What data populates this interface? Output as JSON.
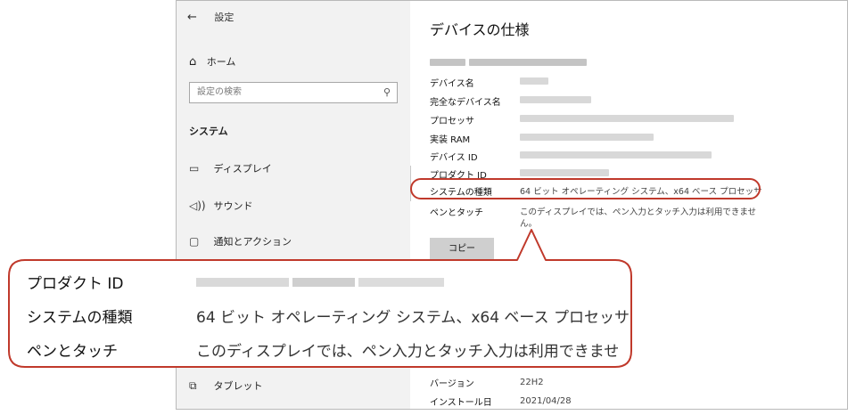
{
  "sidebar": {
    "back_arrow": "←",
    "title": "設定",
    "home_icon": "⌂",
    "home_label": "ホーム",
    "search_placeholder": "設定の検索",
    "search_icon": "⚲",
    "section_label": "システム",
    "items": [
      {
        "icon": "▭",
        "label": "ディスプレイ"
      },
      {
        "icon": "◁))",
        "label": "サウンド"
      },
      {
        "icon": "▢",
        "label": "通知とアクション"
      },
      {
        "icon": "⧉",
        "label": "タブレット"
      }
    ]
  },
  "content": {
    "title": "デバイスの仕様",
    "rows": [
      {
        "label": "デバイス名",
        "value": ""
      },
      {
        "label": "完全なデバイス名",
        "value": ""
      },
      {
        "label": "プロセッサ",
        "value": ""
      },
      {
        "label": "実装 RAM",
        "value": ""
      },
      {
        "label": "デバイス ID",
        "value": ""
      },
      {
        "label": "プロダクト ID",
        "value": ""
      },
      {
        "label": "システムの種類",
        "value": "64 ビット オペレーティング システム、x64 ベース プロセッサ"
      },
      {
        "label": "ペンとタッチ",
        "value": "このディスプレイでは、ペン入力とタッチ入力は利用できませ",
        "value2": "ん。"
      }
    ],
    "copy_label": "コピー",
    "windows_rows": [
      {
        "label": "バージョン",
        "value": "22H2"
      },
      {
        "label": "インストール日",
        "value": "2021/04/28"
      }
    ]
  },
  "callout": {
    "rows": [
      {
        "label": "プロダクト ID",
        "value": ""
      },
      {
        "label": "システムの種類",
        "value": "64 ビット オペレーティング システム、x64 ベース プロセッサ"
      },
      {
        "label": "ペンとタッチ",
        "value": "このディスプレイでは、ペン入力とタッチ入力は利用できませ"
      }
    ],
    "accent_color": "#c0392b"
  }
}
